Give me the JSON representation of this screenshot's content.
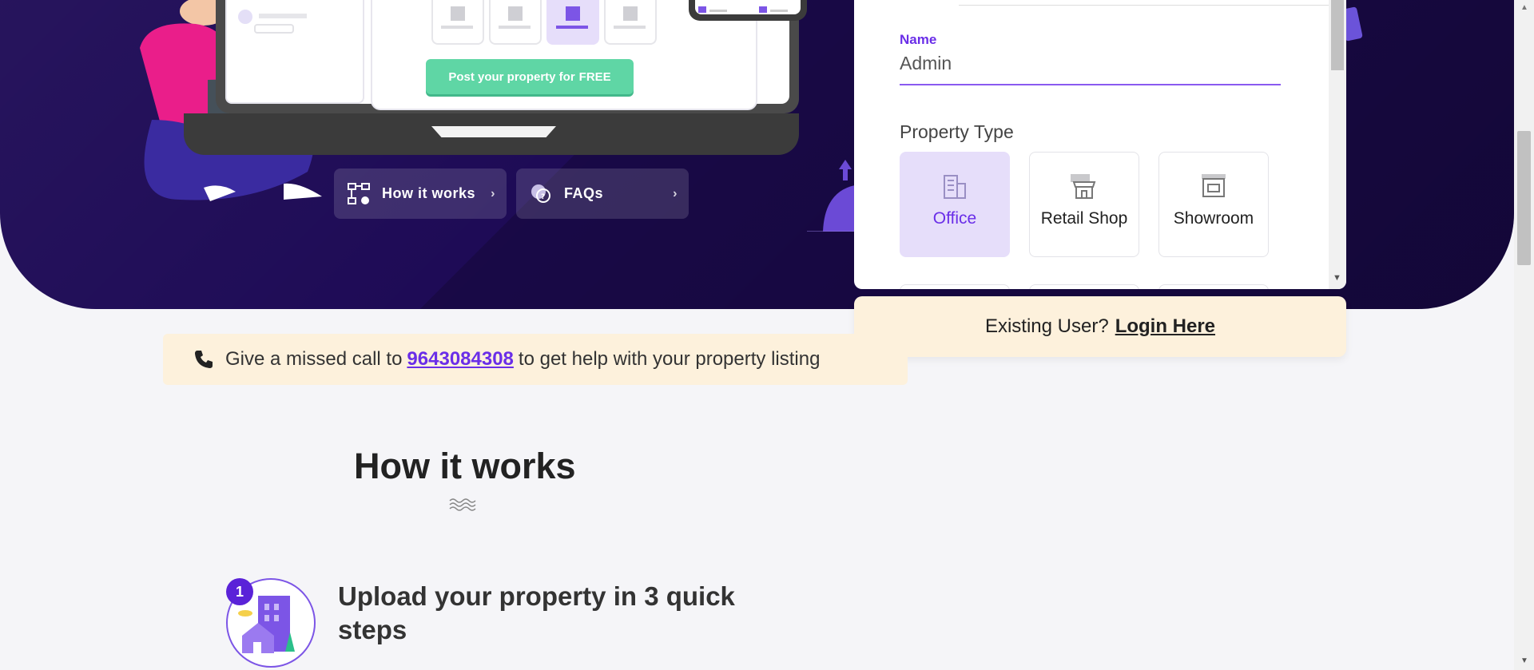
{
  "hero": {
    "post_button_prefix": "Post your property for",
    "post_button_bold": "FREE",
    "quick_links": [
      {
        "label": "How it works",
        "icon": "flowchart-icon"
      },
      {
        "label": "FAQs",
        "icon": "faq-bubble-icon"
      }
    ]
  },
  "form": {
    "name_label": "Name",
    "name_value": "Admin",
    "property_type_label": "Property Type",
    "property_types": [
      {
        "label": "Office",
        "icon": "office-building-icon",
        "selected": true
      },
      {
        "label": "Retail Shop",
        "icon": "shop-storefront-icon",
        "selected": false
      },
      {
        "label": "Showroom",
        "icon": "showroom-icon",
        "selected": false
      }
    ]
  },
  "existing_user": {
    "text": "Existing User?",
    "link": "Login Here"
  },
  "missed_call": {
    "prefix": "Give a missed call to",
    "number": "9643084308",
    "suffix": "to get help with your property listing"
  },
  "how_it_works": {
    "title": "How it works",
    "steps": [
      {
        "number": "1",
        "text": "Upload your property in 3 quick steps"
      }
    ]
  },
  "colors": {
    "accent": "#6a2ee8",
    "hero_bg": "#1e0b56",
    "green_button": "#5fd6a5",
    "notice_bg": "#fdf1dc"
  }
}
